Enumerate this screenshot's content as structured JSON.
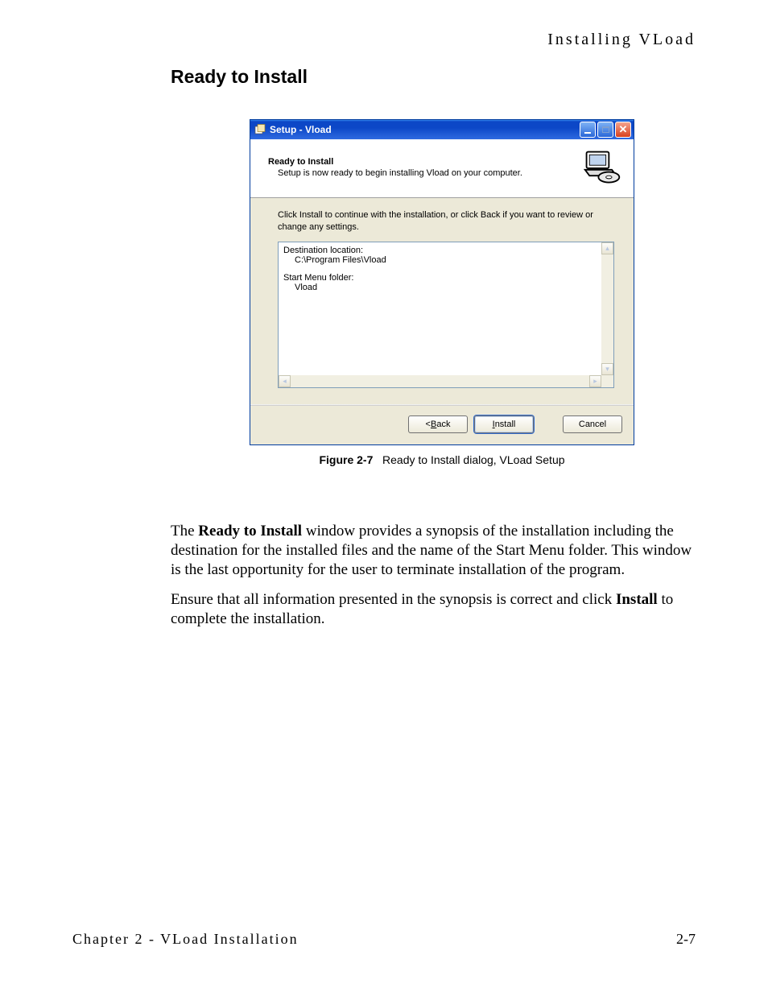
{
  "page_header": "Installing VLoad",
  "section_heading": "Ready to Install",
  "dialog": {
    "title": "Setup - Vload",
    "header_title": "Ready to Install",
    "header_sub": "Setup is now ready to begin installing Vload on your computer.",
    "instruction": "Click Install to continue with the installation, or click Back if you want to review or change any settings.",
    "summary": {
      "dest_label": "Destination location:",
      "dest_value": "C:\\Program Files\\Vload",
      "start_label": "Start Menu folder:",
      "start_value": "Vload"
    },
    "buttons": {
      "back_prefix": "< ",
      "back_u": "B",
      "back_rest": "ack",
      "install_u": "I",
      "install_rest": "nstall",
      "cancel": "Cancel"
    }
  },
  "figure": {
    "label": "Figure 2-7",
    "caption": "Ready to Install dialog, VLoad Setup"
  },
  "para1_a": "The ",
  "para1_b": "Ready to Install",
  "para1_c": " window provides a synopsis of the installation including the destination for the installed files and the name of the Start Menu folder. This window is the last opportunity for the user to terminate installation of the program.",
  "para2_a": "Ensure that all information presented in the synopsis is correct and click ",
  "para2_b": "Install",
  "para2_c": " to complete the installation.",
  "footer_left": "Chapter 2 - VLoad Installation",
  "footer_right": "2-7"
}
